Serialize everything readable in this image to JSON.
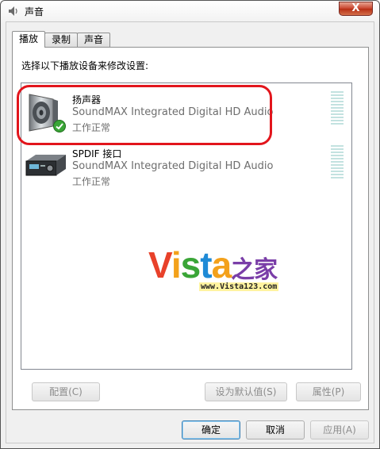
{
  "window": {
    "title": "声音",
    "close_label": "X"
  },
  "tabs": [
    {
      "label": "播放",
      "active": true
    },
    {
      "label": "录制",
      "active": false
    },
    {
      "label": "声音",
      "active": false
    }
  ],
  "playback": {
    "instruction": "选择以下播放设备来修改设置:",
    "devices": [
      {
        "name": "扬声器",
        "description": "SoundMAX Integrated Digital HD Audio",
        "status": "工作正常",
        "icon": "speaker-icon",
        "default_device": true,
        "highlighted": true
      },
      {
        "name": "SPDIF 接口",
        "description": "SoundMAX Integrated Digital HD Audio",
        "status": "工作正常",
        "icon": "spdif-device-icon",
        "default_device": false,
        "highlighted": false
      }
    ],
    "buttons": {
      "configure": "配置(C)",
      "set_default": "设为默认值(S)",
      "properties": "属性(P)"
    }
  },
  "dialog_buttons": {
    "ok": "确定",
    "cancel": "取消",
    "apply": "应用(A)"
  },
  "watermark": {
    "title_parts": [
      "V",
      "i",
      "s",
      "t",
      "a",
      "之家"
    ],
    "url": "www.Vista123.com"
  },
  "colors": {
    "highlight_ring": "#e2151c",
    "level_meter": "#c3e2e0",
    "check_badge": "#3aa537"
  }
}
